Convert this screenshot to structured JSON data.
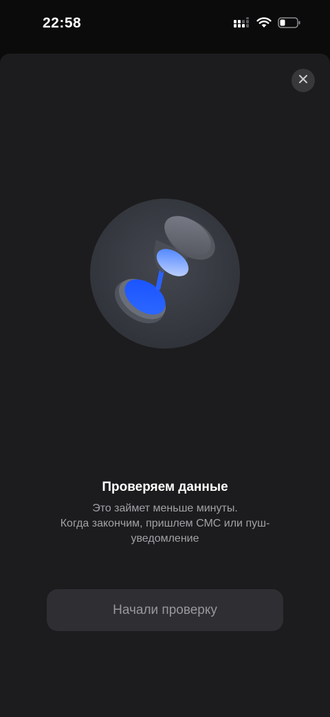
{
  "status_bar": {
    "time": "22:58",
    "icons": [
      "cellular-signal-icon",
      "wifi-icon",
      "battery-icon"
    ],
    "battery_level": 0.2
  },
  "sheet": {
    "close_icon": "close-icon",
    "illustration": "hourglass-icon",
    "title": "Проверяем данные",
    "subtitle_lines": [
      "Это займет меньше минуты.",
      "Когда закончим, пришлем СМС или пуш-",
      "уведомление"
    ],
    "button_label": "Начали проверку"
  },
  "colors": {
    "background": "#0b0b0b",
    "sheet": "#1c1c1e",
    "accent_blue": "#1f5bff",
    "button": "#2f2f33",
    "button_text": "#98989d"
  }
}
